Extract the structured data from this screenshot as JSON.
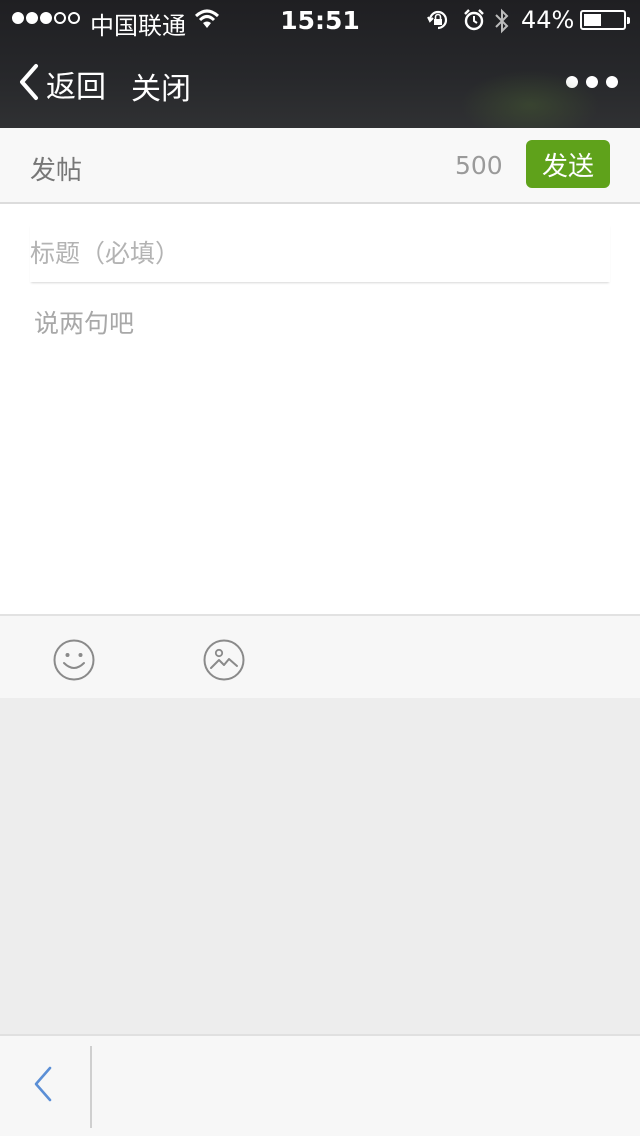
{
  "status_bar": {
    "carrier": "中国联通",
    "time": "15:51",
    "battery_percent": "44%",
    "battery_level": 0.44,
    "signal_strength": 3,
    "signal_max": 5
  },
  "nav": {
    "back_label": "返回",
    "close_label": "关闭"
  },
  "compose": {
    "title": "发帖",
    "char_count": "500",
    "send_label": "发送",
    "send_color": "#5fa21b"
  },
  "editor": {
    "title_placeholder": "标题（必填）",
    "body_placeholder": "说两句吧",
    "title_value": "",
    "body_value": ""
  },
  "attachments": {
    "items": [
      "emoji-icon",
      "image-icon"
    ]
  }
}
